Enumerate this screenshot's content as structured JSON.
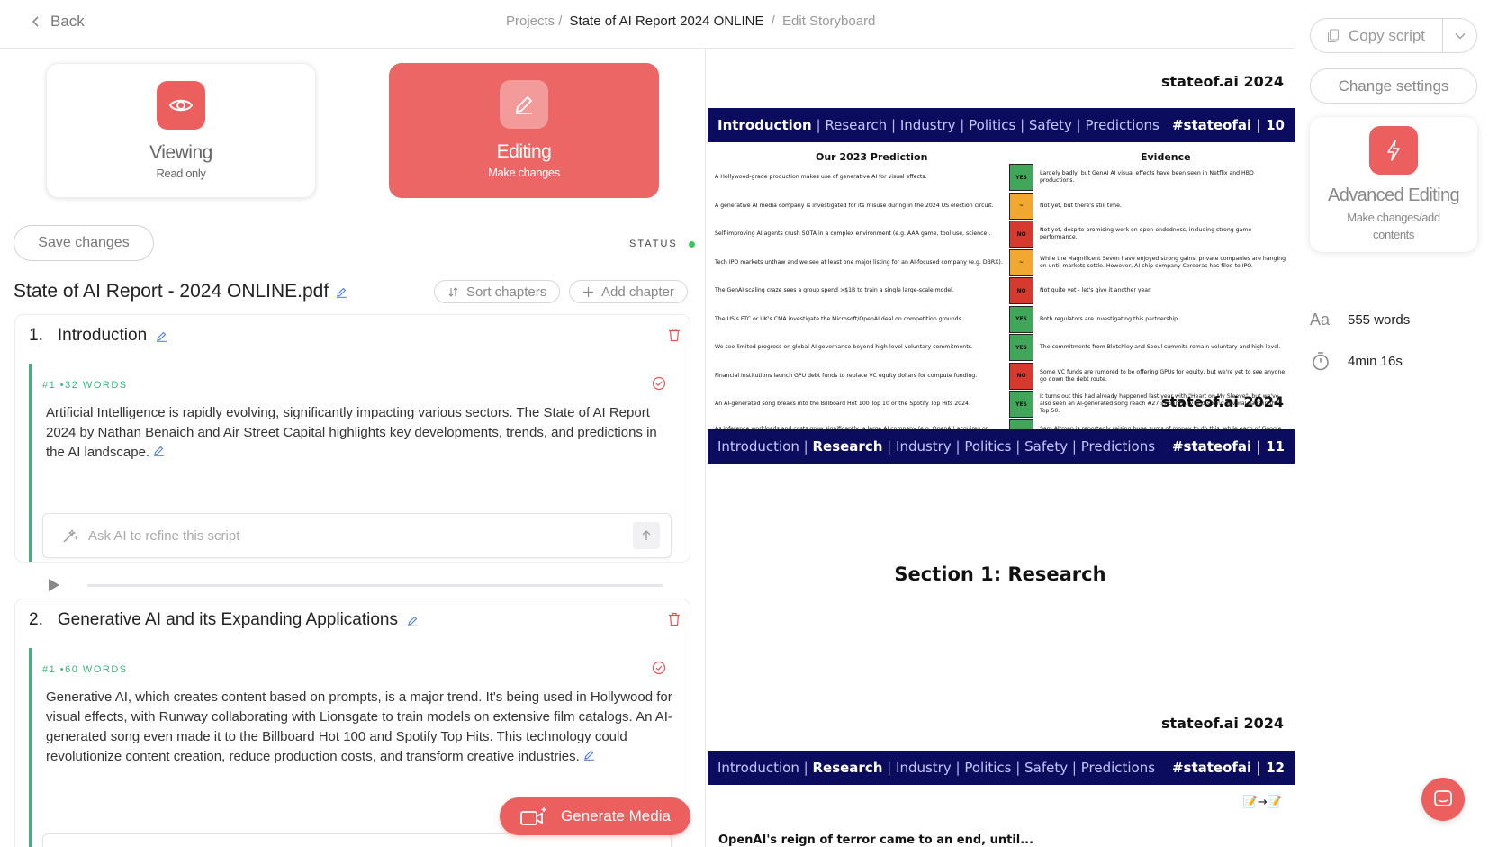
{
  "header": {
    "back_label": "Back",
    "breadcrumb": [
      "Projects",
      "State of AI Report 2024 ONLINE",
      "Edit Storyboard"
    ]
  },
  "modes": {
    "viewing": {
      "title": "Viewing",
      "subtitle": "Read only"
    },
    "editing": {
      "title": "Editing",
      "subtitle": "Make changes"
    }
  },
  "toolbar": {
    "save_label": "Save changes",
    "status_label": "STATUS",
    "status_color": "#3cc45a"
  },
  "document": {
    "title": "State of AI Report - 2024 ONLINE.pdf",
    "sort_label": "Sort chapters",
    "add_label": "Add chapter"
  },
  "chapters": [
    {
      "num": "1.",
      "title": "Introduction",
      "segment_meta": "#1 •32 WORDS",
      "text": "Artificial Intelligence is rapidly evolving, significantly impacting various sectors. The State of AI Report 2024 by Nathan Benaich and Air Street Capital highlights key developments, trends, and predictions in the AI landscape.",
      "refine_placeholder": "Ask AI to refine this script"
    },
    {
      "num": "2.",
      "title": "Generative AI and its Expanding Applications",
      "segment_meta": "#1 •60 WORDS",
      "text": "Generative AI, which creates content based on prompts, is a major trend. It's being used in Hollywood for visual effects, with Runway collaborating with Lionsgate to train models on extensive film catalogs. An AI-generated song even made it to the Billboard Hot 100 and Spotify Top Hits. This technology could revolutionize content creation, reduce production costs, and transform creative industries.",
      "refine_placeholder": "Ask AI to refine this script"
    }
  ],
  "generate_media_label": "Generate Media",
  "preview": {
    "brand": "stateof.ai 2024",
    "nav": {
      "links": [
        "Introduction",
        "Research",
        "Industry",
        "Politics",
        "Safety",
        "Predictions"
      ],
      "sep": "|"
    },
    "slide10": {
      "tag": "#stateofai | 10",
      "left_heading": "Our 2023 Prediction",
      "right_heading": "Evidence",
      "rows": [
        {
          "prediction": "A Hollywood-grade production makes use of generative AI for visual effects.",
          "verdict": "YES",
          "evidence": "Largely badly, but GenAI AI visual effects have been seen in Netflix and HBO productions."
        },
        {
          "prediction": "A generative AI media company is investigated for its misuse during in the 2024 US election circuit.",
          "verdict": "~",
          "evidence": "Not yet, but there's still time."
        },
        {
          "prediction": "Self-improving AI agents crush SOTA in a complex environment (e.g. AAA game, tool use, science).",
          "verdict": "NO",
          "evidence": "Not yet, despite promising work on open-endedness, including strong game performance."
        },
        {
          "prediction": "Tech IPO markets unthaw and we see at least one major listing for an AI-focused company (e.g. DBRX).",
          "verdict": "~",
          "evidence": "While the Magnificent Seven have enjoyed strong gains, private companies are hanging on until markets settle. However, AI chip company Cerebras has filed to IPO."
        },
        {
          "prediction": "The GenAI scaling craze sees a group spend >$1B to train a single large-scale model.",
          "verdict": "NO",
          "evidence": "Not quite yet - let's give it another year."
        },
        {
          "prediction": "The US's FTC or UK's CMA investigate the Microsoft/OpenAI deal on competition grounds.",
          "verdict": "YES",
          "evidence": "Both regulators are investigating this partnership."
        },
        {
          "prediction": "We see limited progress on global AI governance beyond high-level voluntary commitments.",
          "verdict": "YES",
          "evidence": "The commitments from Bletchley and Seoul summits remain voluntary and high-level."
        },
        {
          "prediction": "Financial institutions launch GPU debt funds to replace VC equity dollars for compute funding.",
          "verdict": "NO",
          "evidence": "Some VC funds are rumored to be offering GPUs for equity, but we're yet to see anyone go down the debt route."
        },
        {
          "prediction": "An AI-generated song breaks into the Billboard Hot 100 Top 10 or the Spotify Top Hits 2024.",
          "verdict": "YES",
          "evidence": "It turns out this had already happened last year with \"Heart on My Sleeve\", but we've also seen an AI-generated song reach #27 in Germany and spend several days in the Top 50."
        },
        {
          "prediction": "As inference workloads and costs grow significantly, a large AI company (e.g. OpenAI) acquires or builds an inference-focused AI chip company.",
          "verdict": "YES",
          "evidence": "Sam Altman is reportedly raising huge sums of money to do this, while each of Google, Amazon, Meta and Microsoft continue to build and improve their owned AI silicon."
        }
      ]
    },
    "slide11": {
      "tag": "#stateofai | 11",
      "section_title": "Section 1: Research"
    },
    "slide12": {
      "tag": "#stateofai | 12",
      "heading": "OpenAI's reign of terror came to an end, until...",
      "emoji": "📝→📝"
    }
  },
  "sidebar": {
    "copy_label": "Copy script",
    "settings_label": "Change settings",
    "advanced": {
      "title": "Advanced Editing",
      "subtitle": "Make changes/add contents"
    },
    "words": "555 words",
    "duration": "4min 16s"
  },
  "colors": {
    "accent": "#ec5f5f",
    "editing_card": "#ec6666",
    "segment_green": "#3fb37f",
    "slide_nav": "#0c0c5e",
    "verdict_yes": "#3fa65a",
    "verdict_no": "#d63a2e",
    "verdict_partial": "#f0a830"
  }
}
